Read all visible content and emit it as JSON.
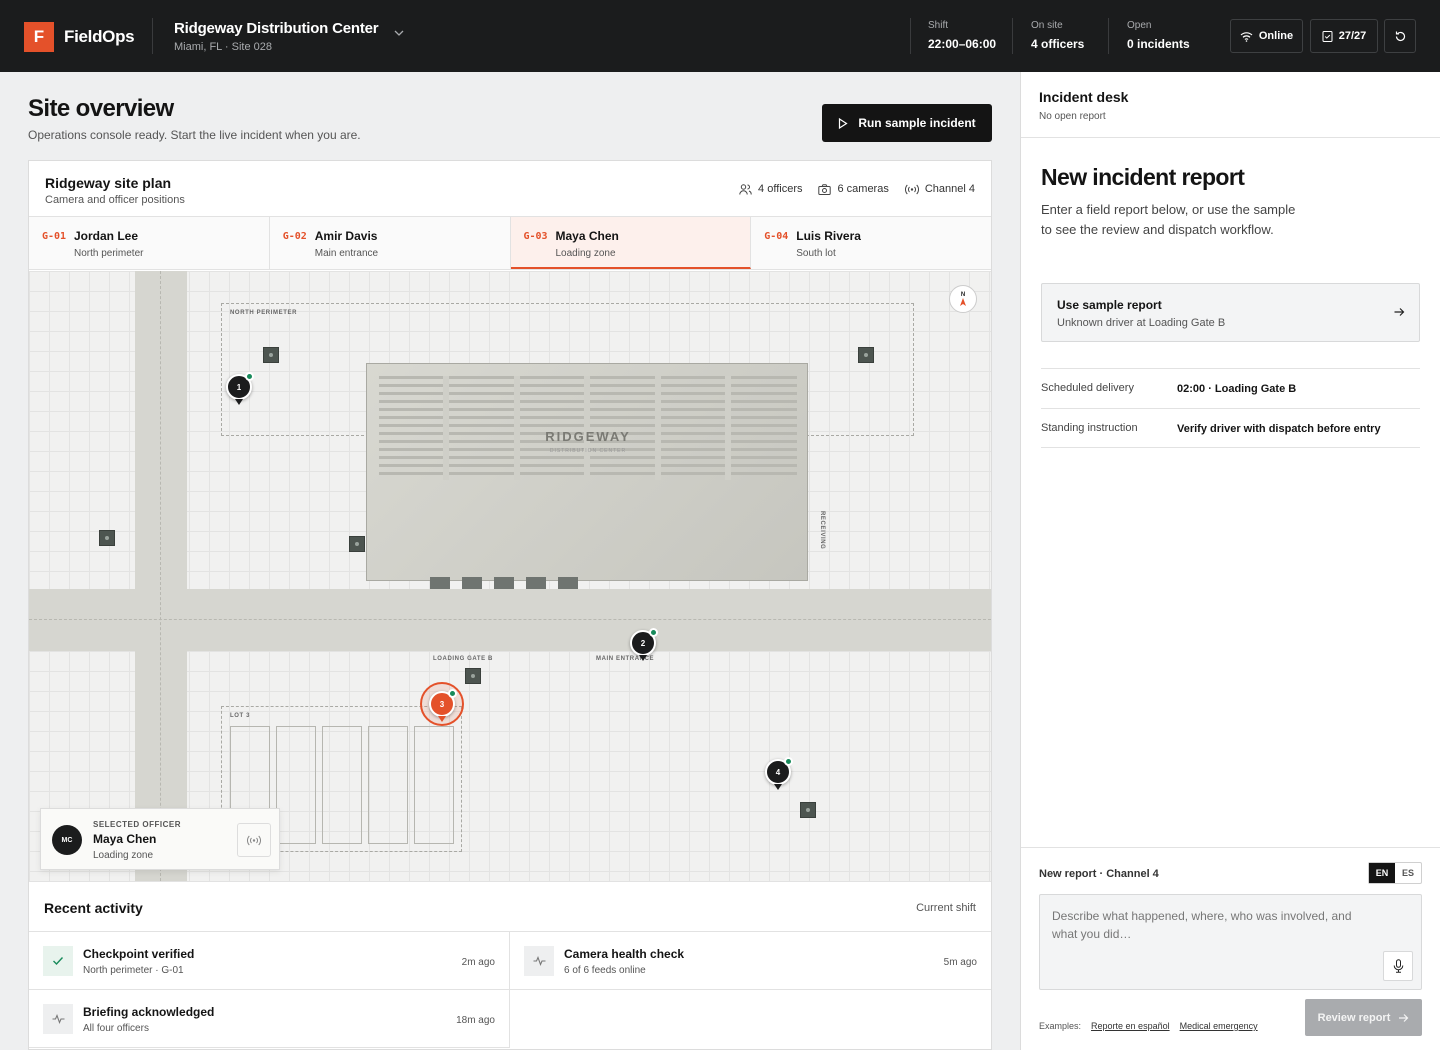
{
  "app": {
    "logo_letter": "F",
    "brand": "FieldOps"
  },
  "site": {
    "name": "Ridgeway Distribution Center",
    "sub": "Miami, FL · Site 028"
  },
  "stats": [
    {
      "label": "Shift",
      "value": "22:00–06:00"
    },
    {
      "label": "On site",
      "value": "4 officers"
    },
    {
      "label": "Open",
      "value": "0 incidents"
    }
  ],
  "topbar_buttons": {
    "online": "Online",
    "checks": "27/27"
  },
  "overview": {
    "title": "Site overview",
    "subtitle": "Operations console ready. Start the live incident when you are.",
    "run_label": "Run sample incident"
  },
  "site_plan": {
    "title": "Ridgeway site plan",
    "subtitle": "Camera and officer positions",
    "meta": {
      "officers": "4 officers",
      "cameras": "6 cameras",
      "channel": "Channel 4"
    }
  },
  "officers": [
    {
      "code": "G-01",
      "name": "Jordan Lee",
      "location": "North perimeter"
    },
    {
      "code": "G-02",
      "name": "Amir Davis",
      "location": "Main entrance"
    },
    {
      "code": "G-03",
      "name": "Maya Chen",
      "location": "Loading zone"
    },
    {
      "code": "G-04",
      "name": "Luis Rivera",
      "location": "South lot"
    }
  ],
  "map": {
    "zone_north": "NORTH PERIMETER",
    "building_name": "RIDGEWAY",
    "building_sub": "DISTRIBUTION CENTER",
    "receiving": "RECEIVING",
    "loading_gate": "LOADING GATE B",
    "main_entrance": "MAIN ENTRANCE",
    "lot": "LOT 3",
    "compass": "N",
    "pins": [
      "1",
      "2",
      "3",
      "4"
    ]
  },
  "selected_officer": {
    "kicker": "SELECTED OFFICER",
    "initials": "MC",
    "name": "Maya Chen",
    "location": "Loading zone"
  },
  "activity": {
    "title": "Recent activity",
    "scope": "Current shift",
    "items": [
      {
        "title": "Checkpoint verified",
        "sub": "North perimeter · G-01",
        "time": "2m ago",
        "icon": "check-icon"
      },
      {
        "title": "Camera health check",
        "sub": "6 of 6 feeds online",
        "time": "5m ago",
        "icon": "pulse-icon"
      },
      {
        "title": "Briefing acknowledged",
        "sub": "All four officers",
        "time": "18m ago",
        "icon": "pulse-icon"
      }
    ]
  },
  "desk": {
    "title": "Incident desk",
    "sub": "No open report"
  },
  "new_report": {
    "title": "New incident report",
    "desc": "Enter a field report below, or use the sample to see the review and dispatch workflow.",
    "sample_title": "Use sample report",
    "sample_sub": "Unknown driver at Loading Gate B",
    "details": [
      {
        "key": "Scheduled delivery",
        "value": "02:00 · Loading Gate B"
      },
      {
        "key": "Standing instruction",
        "value": "Verify driver with dispatch before entry"
      }
    ]
  },
  "compose": {
    "header": "New report · Channel 4",
    "lang_en": "EN",
    "lang_es": "ES",
    "placeholder": "Describe what happened, where, who was involved, and what you did…",
    "examples_label": "Examples:",
    "example_1": "Reporte en español",
    "example_2": "Medical emergency",
    "review_label": "Review report"
  }
}
